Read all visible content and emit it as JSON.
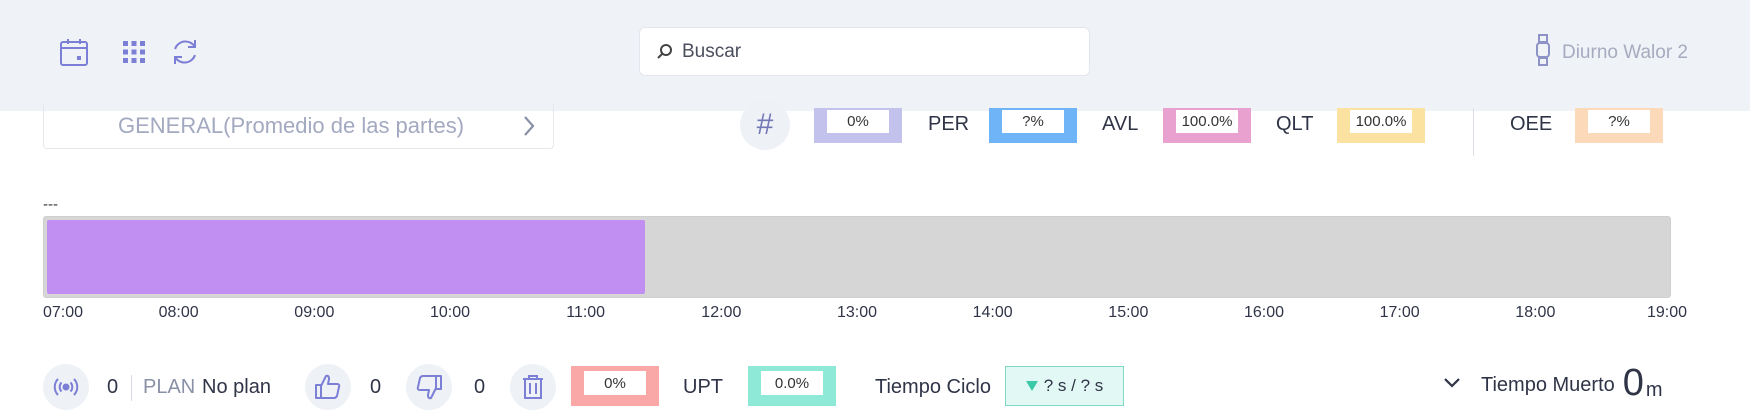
{
  "search": {
    "placeholder": "Buscar"
  },
  "user": {
    "name": "Diurno Walor 2"
  },
  "part_selector": {
    "label": "GENERAL(Promedio de las partes)"
  },
  "metrics": [
    {
      "label": "",
      "value": "0%",
      "color": "#c3c2ed"
    },
    {
      "label": "PER",
      "value": "?%",
      "color": "#6eb4f7"
    },
    {
      "label": "AVL",
      "value": "100.0%",
      "color": "#e9a1cf"
    },
    {
      "label": "QLT",
      "value": "100.0%",
      "color": "#fbe2a0"
    },
    {
      "label": "OEE",
      "value": "?%",
      "color": "#fcd9b8"
    }
  ],
  "timeline": {
    "header": "---",
    "start": "07:00",
    "end": "19:00",
    "fill_until_hours": 4.43,
    "fill_color": "#c18ef2",
    "ticks": [
      "07:00",
      "08:00",
      "09:00",
      "10:00",
      "11:00",
      "12:00",
      "13:00",
      "14:00",
      "15:00",
      "16:00",
      "17:00",
      "18:00",
      "19:00"
    ]
  },
  "bottom": {
    "signal_count": "0",
    "plan_label": "PLAN",
    "plan_value": "No plan",
    "good_count": "0",
    "bad_count": "0",
    "scrap_pct": "0%",
    "scrap_color": "#f9a7a7",
    "upt_label": "UPT",
    "upt_value": "0.0%",
    "upt_color": "#8ee9d6",
    "cycle_label": "Tiempo Ciclo",
    "cycle_value": "? s / ? s",
    "dead_label": "Tiempo Muerto",
    "dead_value": "0",
    "dead_unit": "m"
  }
}
